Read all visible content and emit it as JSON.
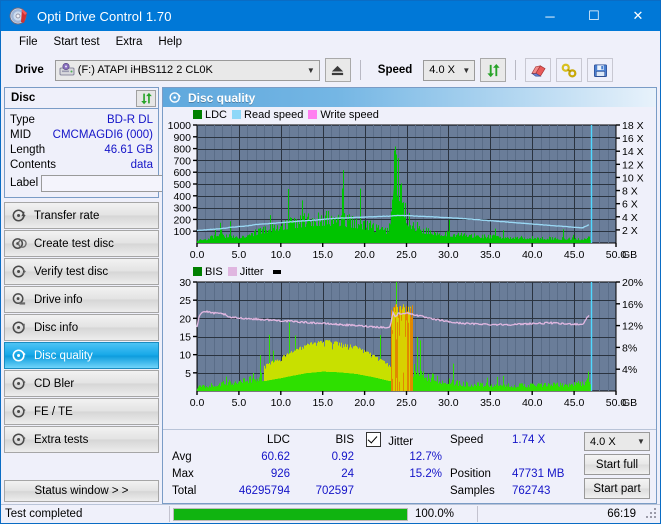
{
  "window": {
    "title": "Opti Drive Control 1.70",
    "icon": "disc-icon",
    "minimize": "─",
    "maximize": "☐",
    "close": "✕"
  },
  "menu": {
    "items": [
      {
        "label": "File",
        "name": "menu-file"
      },
      {
        "label": "Start test",
        "name": "menu-start-test"
      },
      {
        "label": "Extra",
        "name": "menu-extra"
      },
      {
        "label": "Help",
        "name": "menu-help"
      }
    ]
  },
  "toolbar": {
    "drive_label": "Drive",
    "drive_value": "(F:)  ATAPI iHBS112  2 CL0K",
    "eject_icon": "eject-icon",
    "speed_label": "Speed",
    "speed_value": "4.0 X",
    "refresh_icon": "refresh-icon",
    "erase_icon": "eraser-icon",
    "tools_icon": "tools-icon",
    "save_icon": "save-floppy-icon"
  },
  "disc": {
    "header": "Disc",
    "refresh_icon": "refresh-icon",
    "rows": [
      {
        "key": "Type",
        "value": "BD-R DL"
      },
      {
        "key": "MID",
        "value": "CMCMAGDI6 (000)"
      },
      {
        "key": "Length",
        "value": "46.61 GB"
      },
      {
        "key": "Contents",
        "value": "data"
      }
    ],
    "label_key": "Label",
    "label_value": "",
    "label_placeholder": "",
    "label_btn_icon": "disc-icon"
  },
  "nav": {
    "items": [
      {
        "label": "Transfer rate",
        "icon": "disc-speed-icon",
        "active": false
      },
      {
        "label": "Create test disc",
        "icon": "disc-burn-icon",
        "active": false
      },
      {
        "label": "Verify test disc",
        "icon": "disc-verify-icon",
        "active": false
      },
      {
        "label": "Drive info",
        "icon": "drive-info-icon",
        "active": false
      },
      {
        "label": "Disc info",
        "icon": "disc-info-icon",
        "active": false
      },
      {
        "label": "Disc quality",
        "icon": "disc-quality-icon",
        "active": true
      },
      {
        "label": "CD Bler",
        "icon": "disc-bler-icon",
        "active": false
      },
      {
        "label": "FE / TE",
        "icon": "disc-fete-icon",
        "active": false
      },
      {
        "label": "Extra tests",
        "icon": "disc-extra-icon",
        "active": false
      }
    ],
    "status_window": "Status window > >"
  },
  "main": {
    "title": "Disc quality",
    "icon": "disc-quality-icon"
  },
  "chart_data": [
    {
      "type": "area",
      "name": "top-chart",
      "title": "",
      "xlabel": "GB",
      "ylabel": "",
      "xlim": [
        0,
        50
      ],
      "ylim": [
        0,
        1000
      ],
      "y2lim": [
        0,
        18
      ],
      "grid": true,
      "legend_position": "top-left",
      "legend": [
        {
          "label": "LDC",
          "color": "#00a000"
        },
        {
          "label": "Read speed",
          "color": "#8ed8f8"
        },
        {
          "label": "Write speed",
          "color": "#ff7ff0"
        }
      ],
      "xticks": [
        "0.0",
        "5.0",
        "10.0",
        "15.0",
        "20.0",
        "25.0",
        "30.0",
        "35.0",
        "40.0",
        "45.0",
        "50.0"
      ],
      "yticks": [
        "1000",
        "900",
        "800",
        "700",
        "600",
        "500",
        "400",
        "300",
        "200",
        "100"
      ],
      "y2ticks": [
        "18 X",
        "16 X",
        "14 X",
        "12 X",
        "10 X",
        "8 X",
        "6 X",
        "4 X",
        "2 X"
      ],
      "end_marker_gb": 47.0,
      "series": [
        {
          "name": "LDC",
          "color": "#00c400",
          "x": [
            0.0,
            0.4,
            0.8,
            1.2,
            1.6,
            2.0,
            2.4,
            2.8,
            3.2,
            3.6,
            4.0,
            4.4,
            4.8,
            5.2,
            5.6,
            6.0,
            6.4,
            6.8,
            7.2,
            7.6,
            8.0,
            8.4,
            8.8,
            9.2,
            9.6,
            10.0,
            10.4,
            10.8,
            11.2,
            11.6,
            12.0,
            12.4,
            12.8,
            13.2,
            13.6,
            14.0,
            14.4,
            14.8,
            15.2,
            15.6,
            16.0,
            16.4,
            16.8,
            17.2,
            17.6,
            18.0,
            18.4,
            18.8,
            19.2,
            19.6,
            20.0,
            20.4,
            20.8,
            21.2,
            21.6,
            22.0,
            22.4,
            22.8,
            23.2,
            23.4,
            23.6,
            23.8,
            24.0,
            24.2,
            24.4,
            24.8,
            25.2,
            25.6,
            26.0,
            26.4,
            26.8,
            27.2,
            27.6,
            28.0,
            28.8,
            29.6,
            30.4,
            31.2,
            32.0,
            33.0,
            34.0,
            35.0,
            36.0,
            37.0,
            38.0,
            39.0,
            40.0,
            41.0,
            42.0,
            43.0,
            44.0,
            45.0,
            46.0,
            46.8,
            47.0
          ],
          "y": [
            20,
            30,
            35,
            40,
            55,
            60,
            58,
            120,
            65,
            70,
            75,
            68,
            62,
            60,
            72,
            78,
            85,
            95,
            110,
            118,
            128,
            140,
            150,
            158,
            165,
            170,
            180,
            188,
            195,
            200,
            205,
            212,
            218,
            222,
            226,
            230,
            232,
            234,
            236,
            235,
            233,
            230,
            228,
            224,
            220,
            215,
            210,
            204,
            198,
            190,
            182,
            172,
            162,
            150,
            138,
            126,
            118,
            132,
            300,
            640,
            920,
            700,
            610,
            520,
            430,
            300,
            230,
            190,
            165,
            148,
            135,
            126,
            118,
            112,
            100,
            92,
            86,
            80,
            76,
            70,
            66,
            62,
            58,
            56,
            54,
            52,
            50,
            48,
            46,
            44,
            42,
            40,
            38,
            60,
            0
          ]
        },
        {
          "name": "Read speed",
          "color": "#9ad9f5",
          "unit": "X",
          "x": [
            0.0,
            1.0,
            2.0,
            3.0,
            4.0,
            5.0,
            6.0,
            7.0,
            8.0,
            9.0,
            10.0,
            11.0,
            12.0,
            13.0,
            14.0,
            15.0,
            16.0,
            17.0,
            18.0,
            19.0,
            20.0,
            21.0,
            22.0,
            23.0,
            23.5,
            24.0,
            25.0,
            26.0,
            27.0,
            28.0,
            29.0,
            30.0,
            31.0,
            32.0,
            33.0,
            34.0,
            35.0,
            36.0,
            37.0,
            38.0,
            39.0,
            40.0,
            41.0,
            42.0,
            43.0,
            44.0,
            45.0,
            46.0,
            46.8
          ],
          "y": [
            1.9,
            2.0,
            2.1,
            2.2,
            2.4,
            2.5,
            2.6,
            2.8,
            2.9,
            3.0,
            3.1,
            3.2,
            3.3,
            3.4,
            3.5,
            3.6,
            3.7,
            3.8,
            3.85,
            3.9,
            3.95,
            4.0,
            4.05,
            4.1,
            4.15,
            4.2,
            4.2,
            4.1,
            4.05,
            4.0,
            3.9,
            3.85,
            3.8,
            3.7,
            3.6,
            3.5,
            3.4,
            3.3,
            3.2,
            3.1,
            3.0,
            2.9,
            2.8,
            2.7,
            2.6,
            2.5,
            2.4,
            2.3,
            2.8
          ]
        }
      ]
    },
    {
      "type": "area",
      "name": "bottom-chart",
      "title": "",
      "xlabel": "GB",
      "ylabel": "",
      "xlim": [
        0,
        50
      ],
      "ylim": [
        0,
        30
      ],
      "y2lim": [
        0,
        20
      ],
      "grid": true,
      "legend_position": "top-left",
      "legend": [
        {
          "label": "BIS",
          "color": "#00a000"
        },
        {
          "label": "Jitter",
          "color": "#e0b6e0"
        }
      ],
      "xticks": [
        "0.0",
        "5.0",
        "10.0",
        "15.0",
        "20.0",
        "25.0",
        "30.0",
        "35.0",
        "40.0",
        "45.0",
        "50.0"
      ],
      "yticks": [
        "30",
        "25",
        "20",
        "15",
        "10",
        "5"
      ],
      "y2ticks": [
        "20%",
        "16%",
        "12%",
        "8%",
        "4%"
      ],
      "end_marker_gb": 47.0,
      "series": [
        {
          "name": "BIS",
          "color": "#2ee000",
          "x": [
            0.0,
            0.5,
            1.0,
            1.5,
            2.0,
            2.5,
            3.0,
            3.5,
            4.0,
            4.5,
            5.0,
            5.5,
            6.0,
            6.5,
            7.0,
            7.5,
            8.0,
            8.5,
            9.0,
            9.5,
            10.0,
            10.5,
            11.0,
            11.5,
            12.0,
            12.5,
            13.0,
            13.5,
            14.0,
            14.5,
            15.0,
            15.5,
            16.0,
            16.5,
            17.0,
            17.5,
            18.0,
            18.5,
            19.0,
            19.5,
            20.0,
            20.5,
            21.0,
            21.5,
            22.0,
            22.5,
            23.0,
            23.4,
            23.8,
            24.2,
            24.6,
            25.0,
            25.5,
            26.0,
            26.5,
            27.0,
            27.5,
            28.0,
            29.0,
            30.0,
            31.0,
            32.0,
            33.0,
            34.0,
            35.0,
            36.0,
            37.0,
            38.0,
            39.0,
            40.0,
            41.0,
            42.0,
            43.0,
            44.0,
            45.0,
            46.0,
            46.8
          ],
          "y": [
            1.2,
            1.5,
            1.6,
            1.8,
            2.0,
            2.2,
            2.4,
            2.3,
            2.8,
            3.0,
            3.2,
            3.5,
            3.8,
            4.2,
            4.5,
            4.8,
            5.0,
            5.4,
            5.8,
            6.2,
            6.5,
            7.0,
            7.4,
            7.8,
            8.2,
            8.6,
            9.0,
            9.2,
            9.4,
            9.6,
            9.8,
            9.7,
            9.6,
            9.5,
            9.4,
            9.2,
            9.0,
            8.8,
            8.6,
            8.2,
            7.8,
            7.4,
            7.0,
            6.5,
            6.0,
            5.5,
            5.0,
            12.0,
            22.0,
            14.0,
            11.0,
            9.0,
            7.5,
            6.5,
            5.8,
            5.2,
            4.8,
            4.4,
            3.6,
            3.0,
            2.6,
            2.3,
            2.1,
            2.0,
            1.9,
            1.9,
            1.8,
            1.8,
            1.8,
            1.9,
            1.9,
            2.0,
            2.0,
            2.1,
            2.2,
            2.6,
            3.4
          ]
        },
        {
          "name": "Jitter",
          "color": "#e2b8e2",
          "unit": "%",
          "x": [
            0.0,
            0.3,
            0.6,
            1.0,
            1.5,
            2.0,
            2.5,
            3.0,
            3.4,
            3.6,
            4.0,
            5.0,
            6.0,
            7.0,
            8.0,
            9.0,
            10.0,
            11.0,
            12.0,
            13.0,
            14.0,
            15.0,
            16.0,
            17.0,
            18.0,
            19.0,
            20.0,
            21.0,
            22.0,
            23.0,
            23.4,
            23.7,
            24.0,
            25.0,
            26.0,
            27.0,
            28.0,
            29.0,
            30.0,
            31.0,
            32.0,
            33.0,
            34.0,
            35.0,
            36.0,
            37.0,
            38.0,
            39.0,
            40.0,
            41.0,
            42.0,
            43.0,
            44.0,
            45.0,
            46.0,
            46.5,
            46.8
          ],
          "y": [
            11.8,
            14.0,
            14.4,
            14.6,
            14.4,
            14.3,
            14.2,
            14.2,
            14.0,
            13.6,
            13.5,
            13.4,
            13.3,
            13.2,
            13.1,
            13.0,
            12.9,
            12.8,
            12.7,
            12.6,
            12.5,
            12.4,
            12.3,
            12.2,
            12.1,
            12.0,
            11.9,
            11.8,
            11.7,
            11.6,
            14.4,
            13.6,
            14.2,
            14.3,
            14.0,
            13.6,
            13.2,
            13.0,
            12.7,
            12.5,
            12.4,
            12.3,
            12.3,
            12.2,
            12.2,
            12.2,
            12.2,
            12.3,
            12.4,
            12.4,
            12.5,
            12.4,
            12.3,
            12.3,
            12.2,
            13.3,
            14.0
          ]
        }
      ]
    }
  ],
  "stats": {
    "col_headers": {
      "ldc": "LDC",
      "bis": "BIS",
      "jitter": "Jitter"
    },
    "row_labels": {
      "avg": "Avg",
      "max": "Max",
      "total": "Total"
    },
    "jitter_checked": true,
    "values": {
      "avg_ldc": "60.62",
      "avg_bis": "0.92",
      "avg_jitter": "12.7%",
      "max_ldc": "926",
      "max_bis": "24",
      "max_jitter": "15.2%",
      "total_ldc": "46295794",
      "total_bis": "702597",
      "total_jitter": ""
    },
    "speed_label": "Speed",
    "speed_value": "1.74 X",
    "position_label": "Position",
    "position_value": "47731 MB",
    "samples_label": "Samples",
    "samples_value": "762743",
    "speed_select": "4.0 X",
    "start_full": "Start full",
    "start_part": "Start part"
  },
  "statusbar": {
    "message": "Test completed",
    "progress_percent": "100.0%",
    "progress_value": 100,
    "elapsed": "66:19"
  },
  "colors": {
    "accent": "#0078d7",
    "plot_bg": "#6a7d99",
    "ldc_green": "#00c400",
    "bis_green": "#2ee000",
    "read_speed": "#9ad9f5",
    "write_speed": "#ff7ff0",
    "jitter_pink": "#e2b8e2",
    "value_blue": "#1414c8",
    "progress_green": "#10b410"
  }
}
